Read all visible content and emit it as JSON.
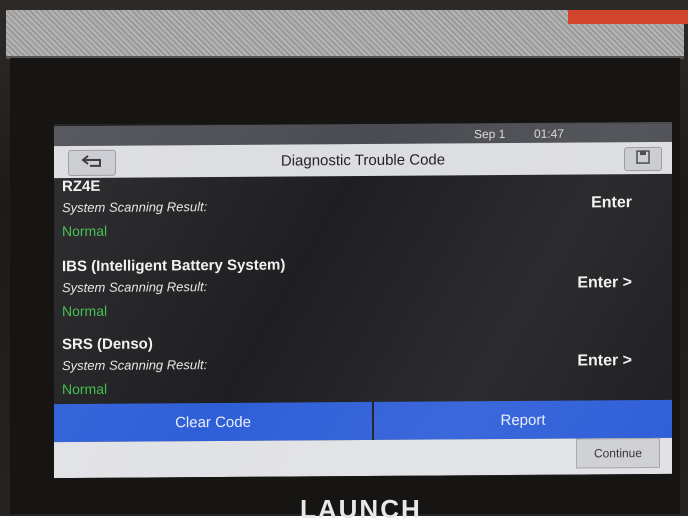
{
  "status_bar": {
    "date": "Sep 1",
    "time": "01:47"
  },
  "header": {
    "title": "Diagnostic Trouble Code",
    "back_icon": "back-arrow-icon",
    "save_icon": "save-icon"
  },
  "systems": [
    {
      "name": "RZ4E",
      "label": "System Scanning Result:",
      "status": "Normal",
      "enter": "Enter"
    },
    {
      "name": "IBS (Intelligent Battery System)",
      "label": "System Scanning Result:",
      "status": "Normal",
      "enter": "Enter >"
    },
    {
      "name": "SRS (Denso)",
      "label": "System Scanning Result:",
      "status": "Normal",
      "enter": "Enter >"
    }
  ],
  "actions": {
    "clear_code": "Clear Code",
    "report": "Report",
    "continue": "Continue"
  },
  "device": {
    "brand": "LAUNCH"
  },
  "colors": {
    "accent_blue": "#2f5fd8",
    "status_normal": "#3fbe4a",
    "title_bar": "#dcdde0"
  }
}
